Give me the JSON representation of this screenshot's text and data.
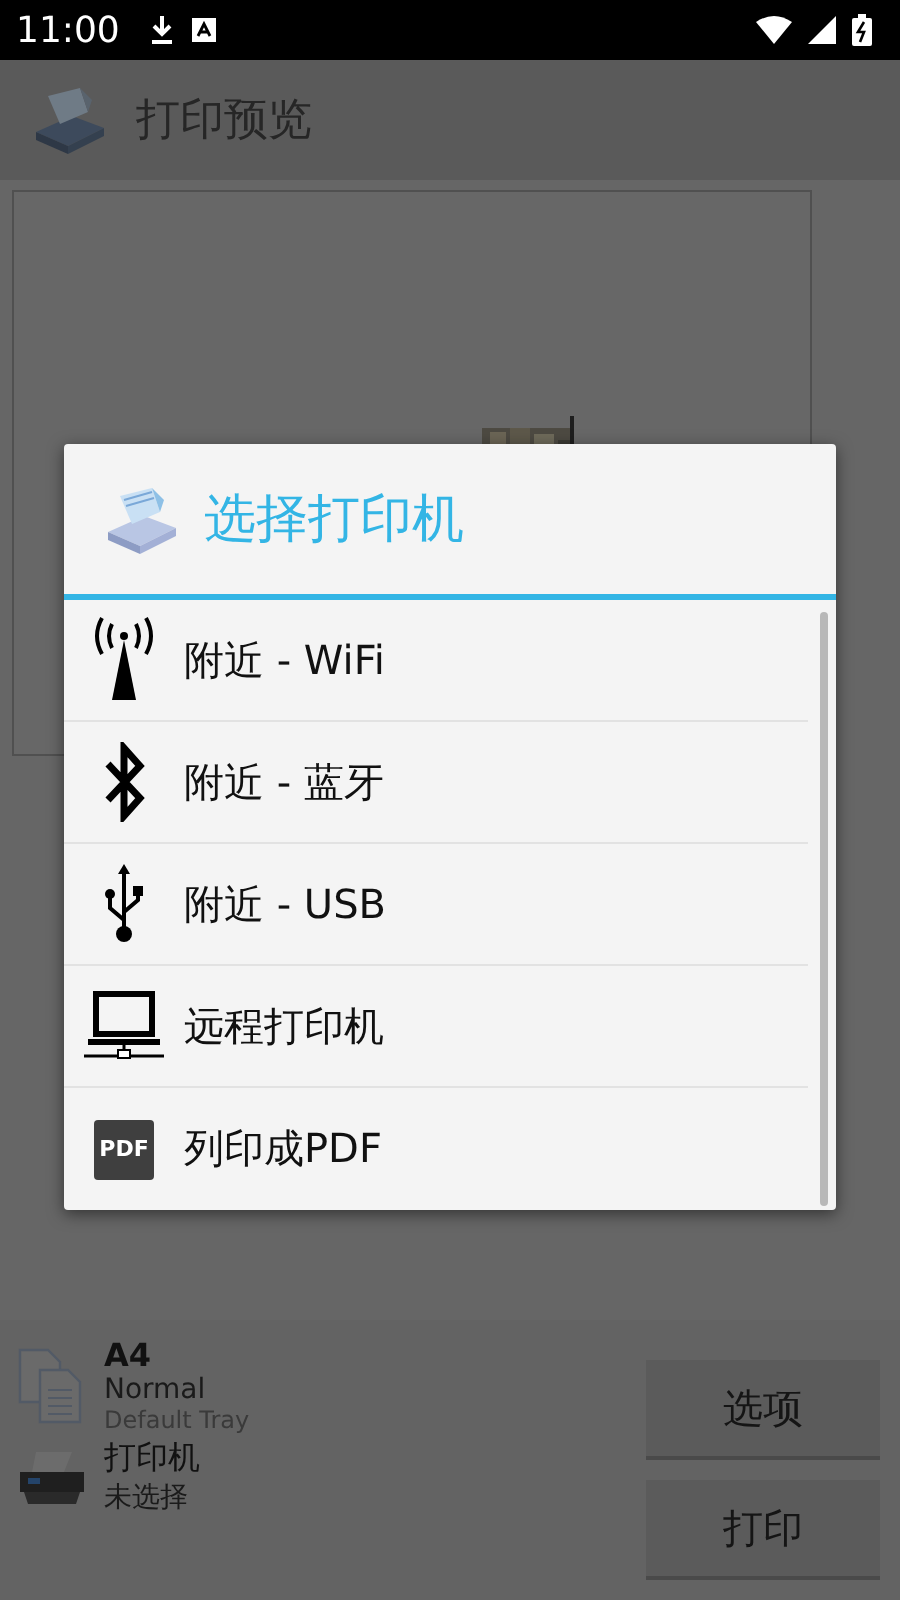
{
  "status_bar": {
    "time": "11:00"
  },
  "app_bar": {
    "title": "打印预览"
  },
  "dialog": {
    "title": "选择打印机",
    "items": [
      {
        "kind": "wifi",
        "label": "附近 - WiFi"
      },
      {
        "kind": "bluetooth",
        "label": "附近 - 蓝牙"
      },
      {
        "kind": "usb",
        "label": "附近 - USB"
      },
      {
        "kind": "remote",
        "label": "远程打印机"
      },
      {
        "kind": "pdf",
        "label": "列印成PDF",
        "icon_text": "PDF"
      }
    ]
  },
  "paper": {
    "size": "A4",
    "quality": "Normal",
    "tray": "Default Tray"
  },
  "printer": {
    "label": "打印机",
    "value": "未选择"
  },
  "buttons": [
    "选项",
    "打印"
  ]
}
